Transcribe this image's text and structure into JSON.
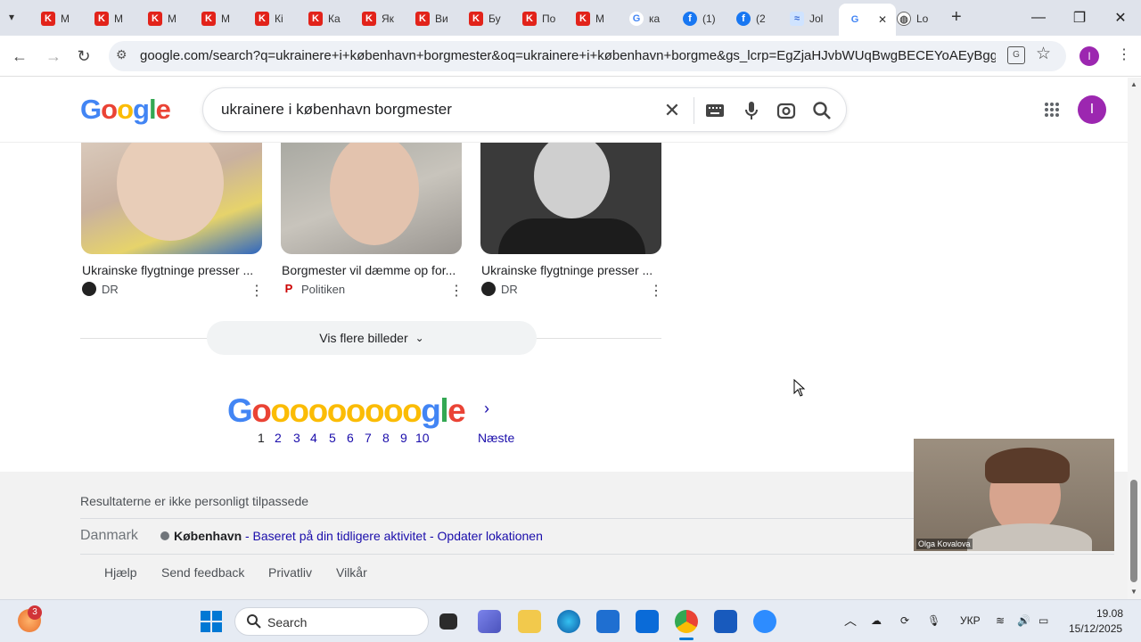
{
  "tabs": [
    {
      "label": "М",
      "icon": "k-logo-icon"
    },
    {
      "label": "М",
      "icon": "k-logo-icon"
    },
    {
      "label": "М",
      "icon": "k-logo-icon"
    },
    {
      "label": "М",
      "icon": "k-logo-icon"
    },
    {
      "label": "Кі",
      "icon": "k-logo-icon"
    },
    {
      "label": "Ка",
      "icon": "k-logo-icon"
    },
    {
      "label": "Як",
      "icon": "k-logo-icon"
    },
    {
      "label": "Ви",
      "icon": "k-logo-icon"
    },
    {
      "label": "Бу",
      "icon": "k-logo-icon"
    },
    {
      "label": "По",
      "icon": "k-logo-icon"
    },
    {
      "label": "М",
      "icon": "k-logo-icon"
    },
    {
      "label": "ка",
      "icon": "google-icon"
    },
    {
      "label": "(1)",
      "icon": "facebook-icon"
    },
    {
      "label": "(2",
      "icon": "facebook-icon"
    },
    {
      "label": "Jol",
      "icon": "jobs-icon"
    },
    {
      "label": "",
      "icon": "google-icon",
      "active": true
    },
    {
      "label": "Lo",
      "icon": "globe-icon"
    }
  ],
  "address_bar": {
    "url": "google.com/search?q=ukrainere+i+københavn+borgmester&oq=ukrainere+i+københavn+borgme&gs_lcrp=EgZjaHJvbWUqBwgBECEYoAEyBggAEEUYO..."
  },
  "search": {
    "query": "ukrainere i københavn borgmester"
  },
  "images": [
    {
      "title": "Ukrainske flygtninge presser ...",
      "source": "DR"
    },
    {
      "title": "Borgmester vil dæmme op for...",
      "source": "Politiken"
    },
    {
      "title": "Ukrainske flygtninge presser ...",
      "source": "DR"
    }
  ],
  "more_images_label": "Vis flere billeder",
  "pagination": {
    "logo": "Goooooooooogle",
    "pages": [
      "1",
      "2",
      "3",
      "4",
      "5",
      "6",
      "7",
      "8",
      "9",
      "10"
    ],
    "next_label": "Næste"
  },
  "footer": {
    "not_personalized": "Resultaterne er ikke personligt tilpassede",
    "country": "Danmark",
    "city": "København",
    "location_basis": "- Baseret på din tidligere aktivitet -",
    "update_location": "Opdater lokationen",
    "links": [
      "Hjælp",
      "Send feedback",
      "Privatliv",
      "Vilkår"
    ]
  },
  "video_overlay": {
    "participant_name": "Olga Kovalova"
  },
  "taskbar": {
    "notification_count": "3",
    "search_label": "Search",
    "language": "УКР",
    "time": "19.08",
    "date": "15/12/2025"
  },
  "colors": {
    "google_blue": "#4285f4",
    "google_red": "#ea4335",
    "google_yellow": "#fbbc05",
    "google_green": "#34a853",
    "link_blue": "#1a0dab"
  }
}
